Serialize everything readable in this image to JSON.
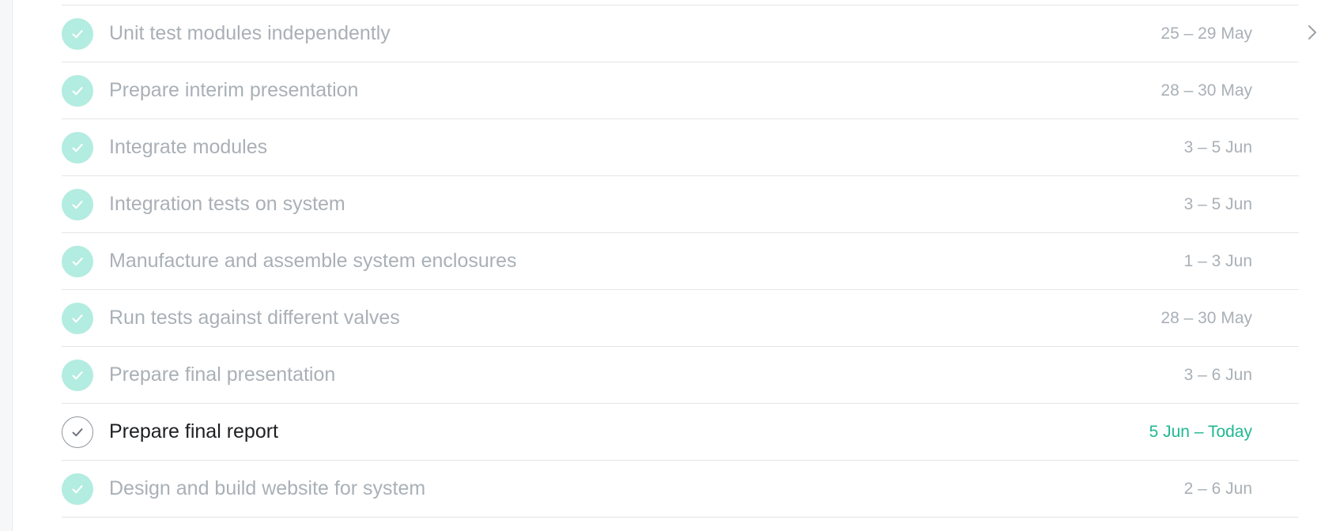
{
  "colors": {
    "done_check_bg": "#b3ece0",
    "muted_text": "#a9b0b6",
    "active_text": "#1d1f22",
    "today_accent": "#1fb893",
    "divider": "#e3e5e7"
  },
  "icons": {
    "done": "checkmark-icon",
    "open": "checkmark-outline-icon",
    "chevron": "chevron-right-icon"
  },
  "tasks": [
    {
      "title": "Unit test modules independently",
      "dates": "25 – 29 May",
      "completed": true
    },
    {
      "title": "Prepare interim presentation",
      "dates": "28 – 30 May",
      "completed": true
    },
    {
      "title": "Integrate modules",
      "dates": "3 – 5 Jun",
      "completed": true
    },
    {
      "title": "Integration tests on system",
      "dates": "3 – 5 Jun",
      "completed": true
    },
    {
      "title": "Manufacture and assemble system enclosures",
      "dates": "1 – 3 Jun",
      "completed": true
    },
    {
      "title": "Run tests against different valves",
      "dates": "28 – 30 May",
      "completed": true
    },
    {
      "title": "Prepare final presentation",
      "dates": "3 – 6 Jun",
      "completed": true
    },
    {
      "title": "Prepare final report",
      "dates": "5 Jun – Today",
      "completed": false
    },
    {
      "title": "Design and build website for system",
      "dates": "2 – 6 Jun",
      "completed": true
    }
  ]
}
